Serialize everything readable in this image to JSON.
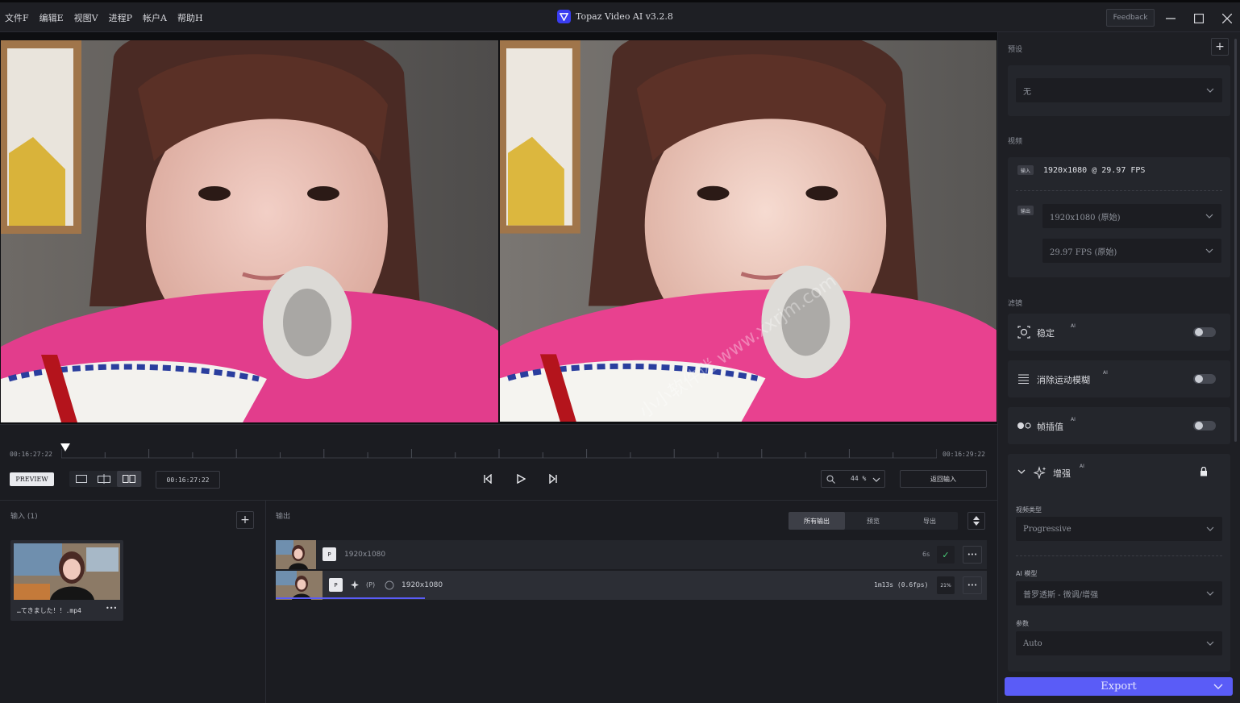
{
  "menu": [
    "文件F",
    "编辑E",
    "视图V",
    "进程P",
    "帐户A",
    "帮助H"
  ],
  "app_title": "Topaz Video AI  v3.2.8",
  "feedback_label": "Feedback",
  "watermark": "小小软件迷 www.xxrjm.com",
  "timeline": {
    "start_time": "00:16:27:22",
    "end_time": "00:16:29:22",
    "preview_label": "PREVIEW",
    "current_time": "00:16:27:22",
    "zoom": "44 %",
    "return_label": "返回输入",
    "playhead_fraction": 0.0
  },
  "input_panel": {
    "title": "输入 (1)",
    "file_name": "…てきました！！.mp4",
    "more": "•••"
  },
  "output_panel": {
    "title": "输出",
    "tabs": [
      "所有输出",
      "预览",
      "导出"
    ],
    "rows": [
      {
        "badge": "P",
        "resolution": "1920x1080",
        "time": "6s",
        "status": "✓"
      },
      {
        "badge": "P",
        "tag": "(P)",
        "resolution": "1920x1080",
        "time": "1m13s (0.6fps)",
        "progress_label": "21%",
        "progress": 0.21
      }
    ],
    "more": "•••"
  },
  "side": {
    "preset_label": "预设",
    "preset_value": "无",
    "video_label": "视频",
    "input_badge": "输入",
    "input_info": "1920x1080 @ 29.97 FPS",
    "output_badge": "输出",
    "output_resolution": "1920x1080 (原始)",
    "output_fps": "29.97 FPS (原始)",
    "filters_label": "滤镜",
    "filters": [
      {
        "label": "稳定",
        "ai": "AI",
        "enabled": false
      },
      {
        "label": "消除运动模糊",
        "ai": "AI",
        "enabled": false
      },
      {
        "label": "帧插值",
        "ai": "AI",
        "enabled": false
      }
    ],
    "enhance_label": "增强",
    "enhance_ai": "AI",
    "video_type_label": "视频类型",
    "video_type_value": "Progressive",
    "ai_model_label": "AI 模型",
    "ai_model_value": "普罗透斯 - 微调/增强",
    "params_label": "参数",
    "params_value": "Auto",
    "export_label": "Export"
  },
  "colors": {
    "accent": "#5a5cf7",
    "panel": "#24262c",
    "background": "#1b1c21"
  }
}
